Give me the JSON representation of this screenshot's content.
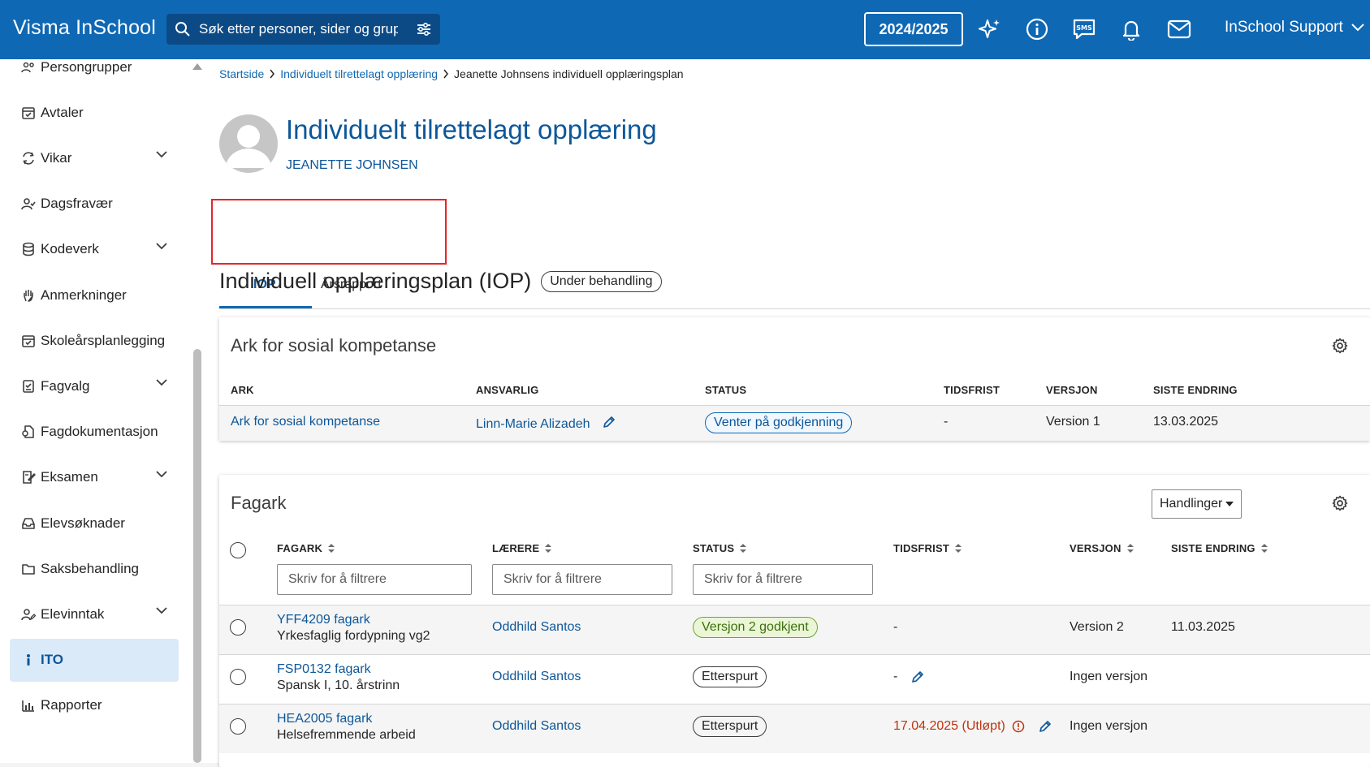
{
  "topbar": {
    "brand": "Visma InSchool",
    "search_placeholder": "Søk etter personer, sider og grupper",
    "year": "2024/2025",
    "user": "InSchool Support",
    "icons": [
      "sparkle-icon",
      "info-icon",
      "sms-icon",
      "bell-icon",
      "mail-icon"
    ]
  },
  "sidebar": {
    "items": [
      {
        "label": "Persongrupper",
        "icon": "people-icon",
        "expandable": false
      },
      {
        "label": "Avtaler",
        "icon": "calendar-check-icon",
        "expandable": false
      },
      {
        "label": "Vikar",
        "icon": "swap-icon",
        "expandable": true
      },
      {
        "label": "Dagsfravær",
        "icon": "person-check-icon",
        "expandable": false
      },
      {
        "label": "Kodeverk",
        "icon": "database-icon",
        "expandable": true
      },
      {
        "label": "Anmerkninger",
        "icon": "hand-icon",
        "expandable": false
      },
      {
        "label": "Skoleårsplanlegging",
        "icon": "calendar-check-icon",
        "expandable": false
      },
      {
        "label": "Fagvalg",
        "icon": "checklist-icon",
        "expandable": true
      },
      {
        "label": "Fagdokumentasjon",
        "icon": "document-icon",
        "expandable": false
      },
      {
        "label": "Eksamen",
        "icon": "exam-icon",
        "expandable": true
      },
      {
        "label": "Elevsøknader",
        "icon": "inbox-icon",
        "expandable": false
      },
      {
        "label": "Saksbehandling",
        "icon": "folder-icon",
        "expandable": false
      },
      {
        "label": "Elevinntak",
        "icon": "person-edit-icon",
        "expandable": true
      },
      {
        "label": "ITO",
        "icon": "person-icon",
        "expandable": false,
        "active": true
      },
      {
        "label": "Rapporter",
        "icon": "bar-chart-icon",
        "expandable": false
      }
    ]
  },
  "breadcrumb": {
    "items": [
      "Startside",
      "Individuelt tilrettelagt opplæring"
    ],
    "current": "Jeanette Johnsens individuell opplæringsplan"
  },
  "header": {
    "title": "Individuelt tilrettelagt opplæring",
    "subtitle": "JEANETTE JOHNSEN"
  },
  "tabs": [
    {
      "label": "IOP",
      "active": true
    },
    {
      "label": "Årsrapport",
      "active": false
    }
  ],
  "section": {
    "title": "Individuell opplæringsplan (IOP)",
    "status": "Under behandling"
  },
  "sosial_card": {
    "title": "Ark for sosial kompetanse",
    "headers": [
      "ARK",
      "ANSVARLIG",
      "STATUS",
      "TIDSFRIST",
      "VERSJON",
      "SISTE ENDRING"
    ],
    "row": {
      "ark": "Ark for sosial kompetanse",
      "ansvarlig": "Linn-Marie Alizadeh",
      "status": "Venter på godkjenning",
      "tidsfrist": "-",
      "versjon": "Version 1",
      "siste_endring": "13.03.2025"
    }
  },
  "fagark_card": {
    "title": "Fagark",
    "actions_label": "Handlinger",
    "headers": [
      "FAGARK",
      "LÆRERE",
      "STATUS",
      "TIDSFRIST",
      "VERSJON",
      "SISTE ENDRING"
    ],
    "filter_placeholder": "Skriv for å filtrere",
    "rows": [
      {
        "code": "YFF4209 fagark",
        "name": "Yrkesfaglig fordypning vg2",
        "teacher": "Oddhild Santos",
        "status": "Versjon 2 godkjent",
        "status_type": "green",
        "deadline": "-",
        "version": "Version 2",
        "changed": "11.03.2025"
      },
      {
        "code": "FSP0132 fagark",
        "name": "Spansk I, 10. årstrinn",
        "teacher": "Oddhild Santos",
        "status": "Etterspurt",
        "status_type": "grey",
        "deadline": "-",
        "version": "Ingen versjon",
        "changed": ""
      },
      {
        "code": "HEA2005 fagark",
        "name": "Helsefremmende arbeid",
        "teacher": "Oddhild Santos",
        "status": "Etterspurt",
        "status_type": "grey",
        "deadline": "17.04.2025 (Utløpt)",
        "version": "Ingen versjon",
        "changed": ""
      }
    ]
  },
  "colors": {
    "brand": "#0f68b4",
    "link": "#0d5799",
    "highlight": "#e5252a",
    "overdue": "#c0330e"
  }
}
